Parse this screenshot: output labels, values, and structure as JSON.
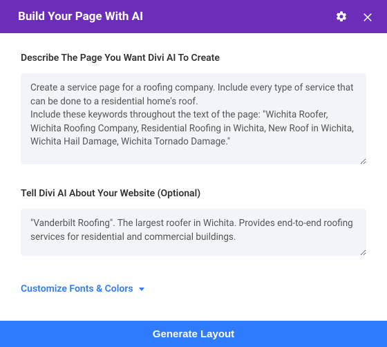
{
  "header": {
    "title": "Build Your Page With AI"
  },
  "fields": {
    "describe": {
      "label": "Describe The Page You Want Divi AI To Create",
      "value": "Create a service page for a roofing company. Include every type of service that can be done to a residential home's roof.\nInclude these keywords throughout the text of the page: \"Wichita Roofer, Wichita Roofing Company, Residential Roofing in Wichita, New Roof in Wichita, Wichita Hail Damage, Wichita Tornado Damage.\""
    },
    "about": {
      "label": "Tell Divi AI About Your Website (Optional)",
      "value": "\"Vanderbilt Roofing\". The largest roofer in Wichita. Provides end-to-end roofing services for residential and commercial buildings."
    }
  },
  "links": {
    "customize": "Customize Fonts & Colors"
  },
  "buttons": {
    "generate": "Generate Layout"
  }
}
